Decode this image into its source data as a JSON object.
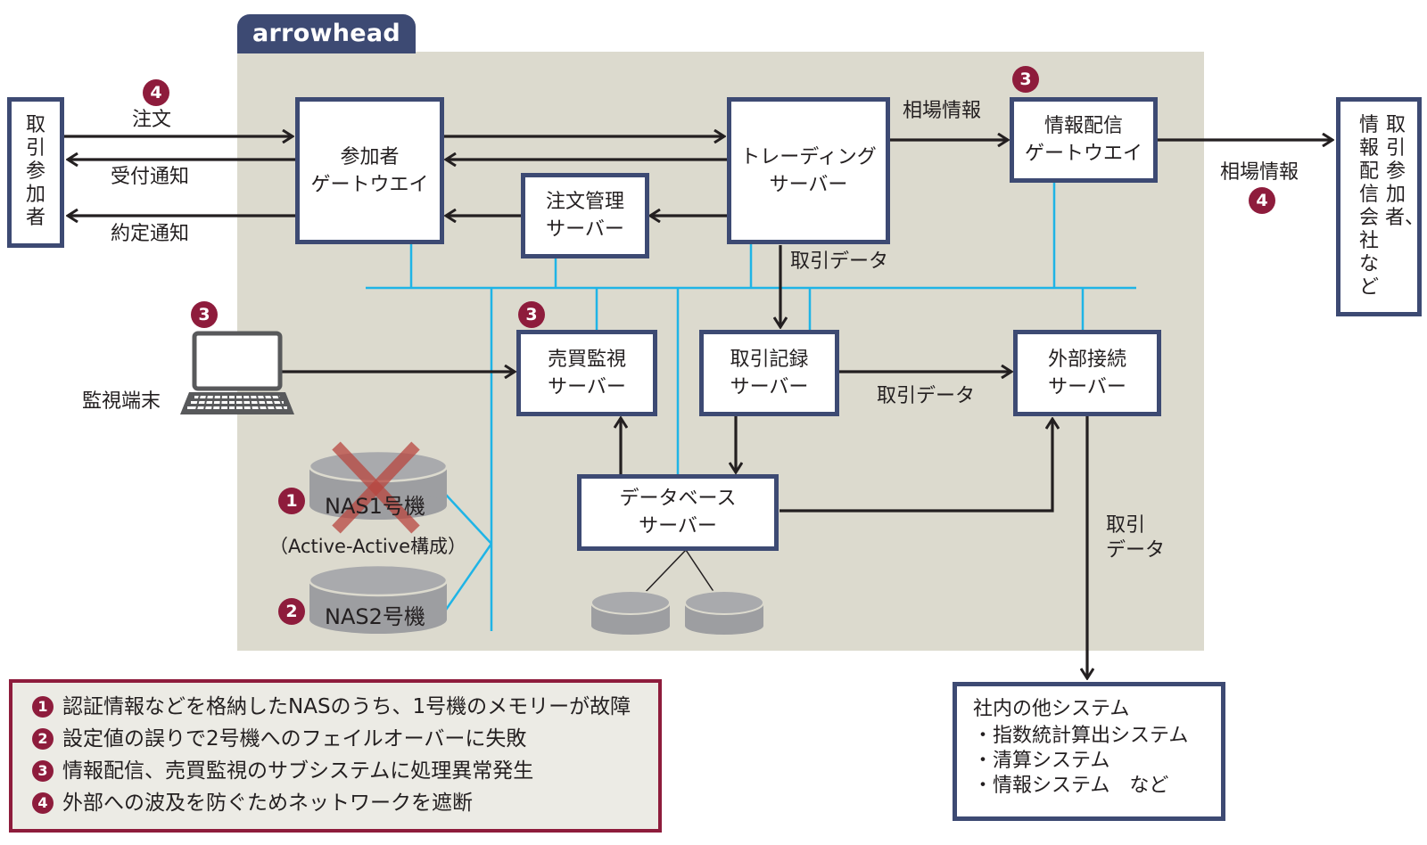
{
  "diagram": {
    "system_name": "arrowhead",
    "colors": {
      "panel_bg": "#dcdace",
      "box_border": "#3d4a73",
      "network_line": "#1fb4e6",
      "badge": "#8e1c3c",
      "arrow": "#231f20",
      "disk": "#9d9ea1",
      "failure_x": "#b8463f"
    },
    "external": {
      "left_participant": "取引参加者",
      "right_recipients_col1": "取引参加者、",
      "right_recipients_col2": "情報配信会社など"
    },
    "boxes": {
      "participant_gw": [
        "参加者",
        "ゲートウエイ"
      ],
      "trading_server": [
        "トレーディング",
        "サーバー"
      ],
      "order_mgmt": [
        "注文管理",
        "サーバー"
      ],
      "info_dist_gw": [
        "情報配信",
        "ゲートウエイ"
      ],
      "trade_monitor": [
        "売買監視",
        "サーバー"
      ],
      "trade_record": [
        "取引記録",
        "サーバー"
      ],
      "external_conn": [
        "外部接続",
        "サーバー"
      ],
      "database": [
        "データベース",
        "サーバー"
      ]
    },
    "flow_labels": {
      "order": "注文",
      "ack": "受付通知",
      "execution": "約定通知",
      "market_info_1": "相場情報",
      "market_info_2": "相場情報",
      "trade_data_1": "取引データ",
      "trade_data_2": "取引データ",
      "trade_data_3a": "取引",
      "trade_data_3b": "データ",
      "monitor_terminal": "監視端末"
    },
    "nas": {
      "nas1": "NAS1号機",
      "nas2": "NAS2号機",
      "config": "（Active-Active構成）"
    },
    "badges": {
      "order_badge": "4",
      "info_gw_badge": "3",
      "market_out_badge": "4",
      "terminal_badge": "3",
      "monitor_badge": "3",
      "nas1_badge": "1",
      "nas2_badge": "2"
    },
    "other_systems": {
      "title": "社内の他システム",
      "items": [
        "・指数統計算出システム",
        "・清算システム",
        "・情報システム　など"
      ]
    },
    "legend": [
      {
        "num": "1",
        "text": "認証情報などを格納したNASのうち、1号機のメモリーが故障"
      },
      {
        "num": "2",
        "text": "設定値の誤りで2号機へのフェイルオーバーに失敗"
      },
      {
        "num": "3",
        "text": "情報配信、売買監視のサブシステムに処理異常発生"
      },
      {
        "num": "4",
        "text": "外部への波及を防ぐためネットワークを遮断"
      }
    ]
  }
}
